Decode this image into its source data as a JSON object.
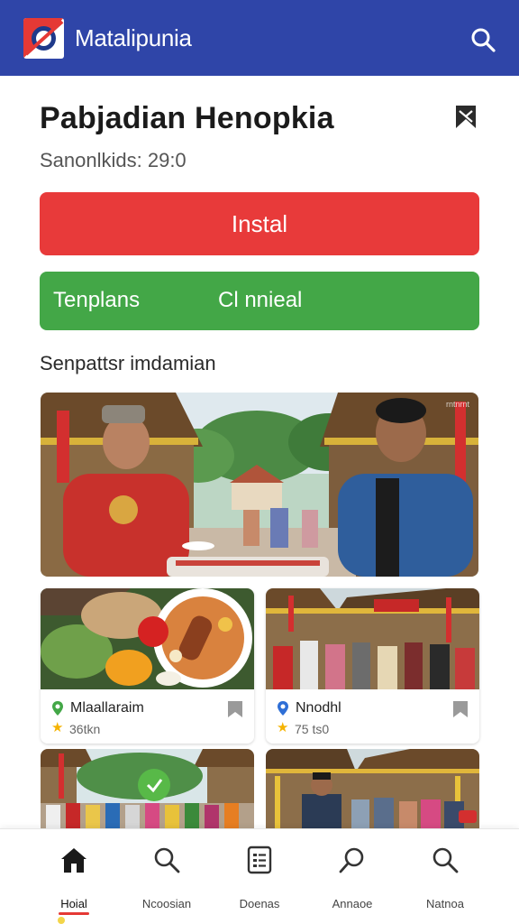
{
  "topbar": {
    "title": "Matalipunia",
    "logo_icon": "app-logo-icon",
    "search_icon": "search-icon",
    "color": "#2f45a8"
  },
  "header": {
    "title": "Pabjadian Henopkia",
    "bookmark_icon": "bookmark-icon",
    "subtitle": "Sanonlkids: 29:0"
  },
  "actions": {
    "install_label": "Instal",
    "install_color": "#e83a3a",
    "green_left_label": "Tenplans",
    "green_right_label": "Cl nnieal",
    "green_color": "#43a747"
  },
  "section": {
    "heading": "Senpattsr imdamian",
    "hero_watermark": "rntnrnt"
  },
  "cards": [
    {
      "place": "Mlaallaraim",
      "rating": "36tkn",
      "pin_color": "#43a747",
      "pin_icon": "location-pin-icon",
      "save_icon": "bookmark-icon",
      "star_icon": "star-icon"
    },
    {
      "place": "Nnodhl",
      "rating": "75 ts0",
      "pin_color": "#2f6fd6",
      "pin_icon": "location-pin-icon",
      "save_icon": "bookmark-icon",
      "star_icon": "star-icon"
    }
  ],
  "nav": [
    {
      "label": "Hoial",
      "icon": "home-icon",
      "active": true
    },
    {
      "label": "Ncoosian",
      "icon": "search-icon"
    },
    {
      "label": "Doenas",
      "icon": "document-list-icon"
    },
    {
      "label": "Annaoe",
      "icon": "search-icon"
    },
    {
      "label": "Natnoa",
      "icon": "search-icon"
    }
  ]
}
